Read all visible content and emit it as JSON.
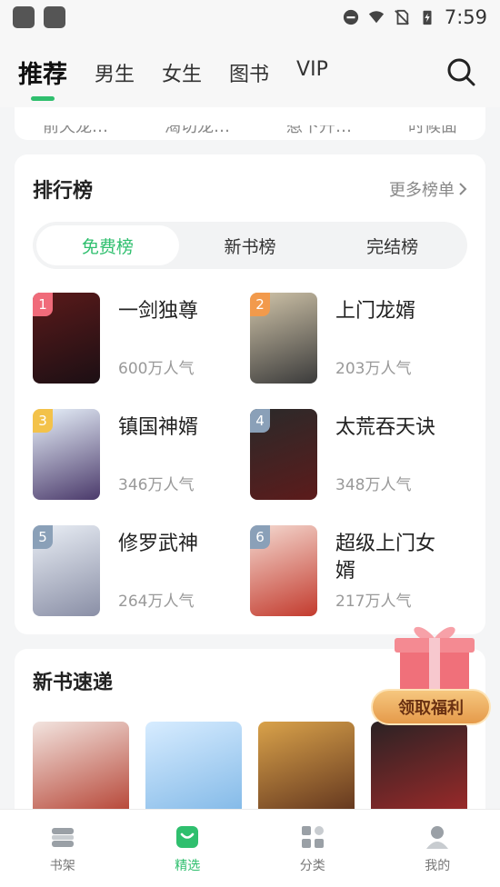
{
  "status_bar": {
    "time": "7:59"
  },
  "top_tabs": [
    {
      "label": "推荐",
      "active": true
    },
    {
      "label": "男生",
      "active": false
    },
    {
      "label": "女生",
      "active": false
    },
    {
      "label": "图书",
      "active": false
    },
    {
      "label": "VIP",
      "active": false
    }
  ],
  "top_card_partial": [
    "前天龙…",
    "渴切龙…",
    "惹下升…",
    "时候面"
  ],
  "ranking": {
    "title": "排行榜",
    "more": "更多榜单",
    "segments": [
      {
        "label": "免费榜",
        "active": true
      },
      {
        "label": "新书榜",
        "active": false
      },
      {
        "label": "完结榜",
        "active": false
      }
    ],
    "books": [
      {
        "rank": "1",
        "name": "一剑独尊",
        "popularity": "600万人气",
        "badge_color": "#f06b7a",
        "cover_a": "#5a1a1a",
        "cover_b": "#1c0f14"
      },
      {
        "rank": "2",
        "name": "上门龙婿",
        "popularity": "203万人气",
        "badge_color": "#f29a4c",
        "cover_a": "#cfc3a8",
        "cover_b": "#3b3b3b"
      },
      {
        "rank": "3",
        "name": "镇国神婿",
        "popularity": "346万人气",
        "badge_color": "#f3c24a",
        "cover_a": "#e8f2fb",
        "cover_b": "#4b3a6b"
      },
      {
        "rank": "4",
        "name": "太荒吞天诀",
        "popularity": "348万人气",
        "badge_color": "#8aa0b8",
        "cover_a": "#2a2a2a",
        "cover_b": "#5c1b1b"
      },
      {
        "rank": "5",
        "name": "修罗武神",
        "popularity": "264万人气",
        "badge_color": "#8aa0b8",
        "cover_a": "#e9eef5",
        "cover_b": "#8a8fa6"
      },
      {
        "rank": "6",
        "name": "超级上门女婿",
        "popularity": "217万人气",
        "badge_color": "#8aa0b8",
        "cover_a": "#f4d9d0",
        "cover_b": "#c33b2e"
      }
    ]
  },
  "new_books": {
    "title": "新书速递",
    "covers": [
      {
        "a": "#f2e4df",
        "b": "#b23a2a"
      },
      {
        "a": "#d7ecff",
        "b": "#7db6e6"
      },
      {
        "a": "#d9a24a",
        "b": "#5a2e1b"
      },
      {
        "a": "#2a2224",
        "b": "#a32a2a"
      }
    ]
  },
  "gift": {
    "label": "领取福利"
  },
  "bottom_nav": [
    {
      "label": "书架",
      "icon": "bookshelf-icon",
      "active": false
    },
    {
      "label": "精选",
      "icon": "featured-bag-icon",
      "active": true
    },
    {
      "label": "分类",
      "icon": "category-grid-icon",
      "active": false
    },
    {
      "label": "我的",
      "icon": "profile-icon",
      "active": false
    }
  ],
  "colors": {
    "accent": "#2fbf6e"
  }
}
